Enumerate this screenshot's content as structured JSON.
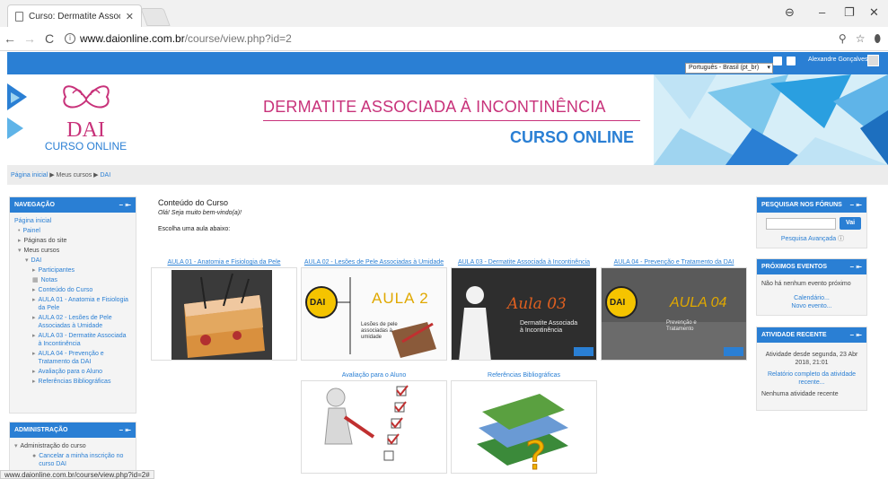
{
  "browser": {
    "tab_title": "Curso: Dermatite Associa",
    "url_host": "www.daionline.com.br",
    "url_path": "/course/view.php?id=2",
    "status_url": "www.daionline.com.br/course/view.php?id=2#"
  },
  "topbar": {
    "language": "Português - Brasil (pt_br)",
    "user_name": "Alexandre Gonçalves"
  },
  "banner": {
    "logo_letters": "DAI",
    "logo_subtitle": "CURSO ONLINE",
    "title": "DERMATITE ASSOCIADA À INCONTINÊNCIA",
    "subtitle": "CURSO ONLINE"
  },
  "breadcrumb": {
    "home": "Página inicial",
    "my_courses": "Meus cursos",
    "course": "DAI"
  },
  "navigation": {
    "title": "NAVEGAÇÃO",
    "home": "Página inicial",
    "dashboard": "Painel",
    "site_pages": "Páginas do site",
    "my_courses": "Meus cursos",
    "course": "DAI",
    "participants": "Participantes",
    "grades": "Notas",
    "content": "Conteúdo do Curso",
    "lesson1": "AULA 01 - Anatomia e Fisiologia da Pele",
    "lesson2": "AULA 02 - Lesões de Pele Associadas à Umidade",
    "lesson3": "AULA 03 - Dermatite Associada à Incontinência",
    "lesson4": "AULA 04 - Prevenção e Tratamento da DAI",
    "evaluation": "Avaliação para o Aluno",
    "references": "Referências Bibliográficas"
  },
  "administration": {
    "title": "ADMINISTRAÇÃO",
    "course_admin": "Administração do curso",
    "unenrol": "Cancelar a minha inscrição no curso DAI"
  },
  "main": {
    "title": "Conteúdo do Curso",
    "welcome": "Olá! Seja muito bem-vindo(a)!",
    "choose": "Escolha uma aula abaixo:",
    "cards": [
      {
        "title": "AULA 01 - Anatomia e Fisiologia da Pele"
      },
      {
        "title": "AULA 02 - Lesões de Pele Associadas à Umidade",
        "img_badge": "DAI",
        "img_title": "AULA 2",
        "img_sub": "Lesões de pele associadas à umidade"
      },
      {
        "title": "AULA 03 - Dermatite Associada à Incontinência",
        "img_title": "Aula 03",
        "img_sub": "Dermatite Associada à Incontinência"
      },
      {
        "title": "AULA 04 - Prevenção e Tratamento da DAI",
        "img_badge": "DAI",
        "img_title": "AULA 04",
        "img_sub": "Prevenção e Tratamento"
      },
      {
        "title": "Avaliação para o Aluno"
      },
      {
        "title": "Referências Bibliográficas"
      }
    ]
  },
  "forum_search": {
    "title": "PESQUISAR NOS FÓRUNS",
    "button": "Vai",
    "advanced": "Pesquisa Avançada"
  },
  "events": {
    "title": "PRÓXIMOS EVENTOS",
    "none": "Não há nenhum evento próximo",
    "calendar": "Calendário...",
    "new_event": "Novo evento..."
  },
  "recent": {
    "title": "ATIVIDADE RECENTE",
    "since": "Atividade desde segunda, 23 Abr 2018, 21:01",
    "full_report": "Relatório completo da atividade recente...",
    "none": "Nenhuma atividade recente"
  },
  "colors": {
    "accent": "#2a7fd4",
    "brand_pink": "#c8327a"
  }
}
